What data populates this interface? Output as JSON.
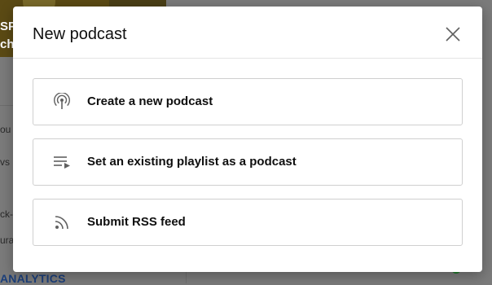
{
  "modal": {
    "title": "New podcast",
    "close_icon": "close-icon",
    "options": [
      {
        "label": "Create a new podcast",
        "icon": "podcast-icon"
      },
      {
        "label": "Set an existing playlist as a podcast",
        "icon": "playlist-play-icon"
      },
      {
        "label": "Submit RSS feed",
        "icon": "rss-feed-icon"
      }
    ]
  },
  "background": {
    "thumb_text": [
      "SP",
      "ch"
    ],
    "sidebar_fragments": [
      "ou",
      "vs",
      "ck-",
      "ura"
    ],
    "analytics_label": "ANALYTICS"
  },
  "colors": {
    "overlay": "#7b7b7b",
    "modal_bg": "#ffffff",
    "border": "#cfcfcf",
    "text": "#0f0f0f",
    "icon": "#606060",
    "analytics_link": "#1c3f7a"
  }
}
